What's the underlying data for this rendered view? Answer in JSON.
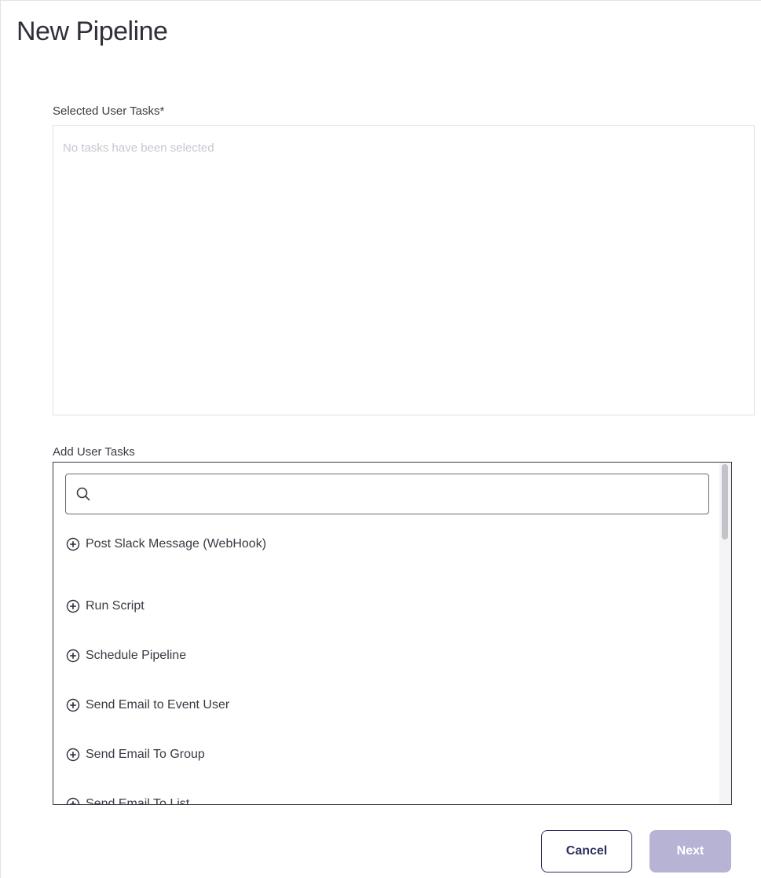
{
  "page": {
    "title": "New Pipeline"
  },
  "selected_tasks": {
    "label": "Selected User Tasks*",
    "empty_message": "No tasks have been selected"
  },
  "add_tasks": {
    "label": "Add User Tasks",
    "search": {
      "value": "",
      "placeholder": "",
      "icon": "search-icon"
    },
    "items": [
      {
        "label": "Post Slack Message (WebHook)",
        "icon": "add-circle-icon"
      },
      {
        "label": "Run Script",
        "icon": "add-circle-icon"
      },
      {
        "label": "Schedule Pipeline",
        "icon": "add-circle-icon"
      },
      {
        "label": "Send Email to Event User",
        "icon": "add-circle-icon"
      },
      {
        "label": "Send Email To Group",
        "icon": "add-circle-icon"
      },
      {
        "label": "Send Email To List",
        "icon": "add-circle-icon"
      }
    ]
  },
  "actions": {
    "cancel_label": "Cancel",
    "next_label": "Next",
    "next_disabled": true
  },
  "colors": {
    "primary": "#2e2e5c",
    "primary_disabled": "#b6b3d4",
    "border": "#e2e2e8",
    "placeholder_text": "#c7c7d2"
  }
}
